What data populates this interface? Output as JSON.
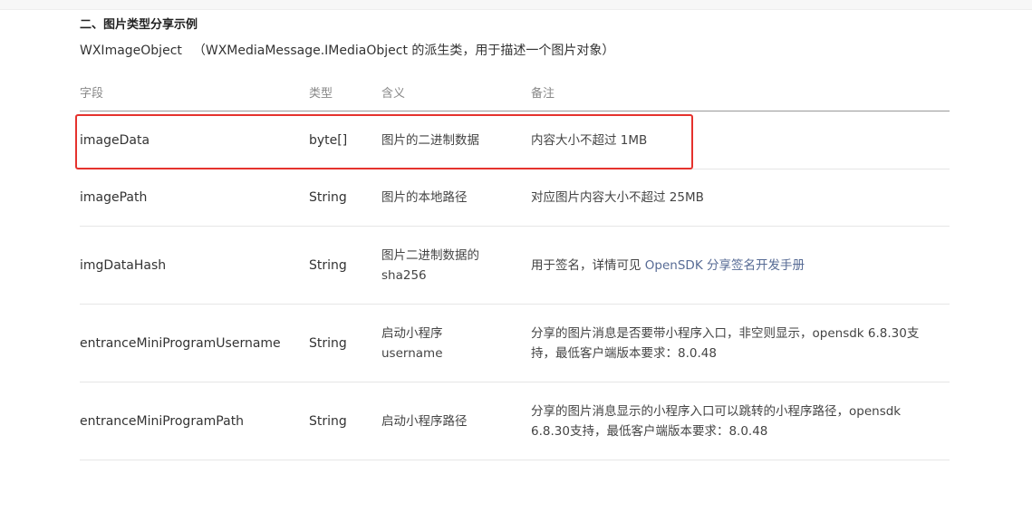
{
  "section": {
    "title": "二、图片类型分享示例"
  },
  "intro": {
    "class_name": "WXImageObject",
    "description": "（WXMediaMessage.IMediaObject 的派生类，用于描述一个图片对象）"
  },
  "table": {
    "headers": {
      "field": "字段",
      "type": "类型",
      "meaning": "含义",
      "note": "备注"
    },
    "rows": [
      {
        "field": "imageData",
        "type": "byte[]",
        "meaning": "图片的二进制数据",
        "note": "内容大小不超过 1MB"
      },
      {
        "field": "imagePath",
        "type": "String",
        "meaning": "图片的本地路径",
        "note": "对应图片内容大小不超过 25MB"
      },
      {
        "field": "imgDataHash",
        "type": "String",
        "meaning": "图片二进制数据的 sha256",
        "note_prefix": "用于签名，详情可见 ",
        "note_link": "OpenSDK 分享签名开发手册"
      },
      {
        "field": "entranceMiniProgramUsername",
        "type": "String",
        "meaning": "启动小程序 username",
        "note": "分享的图片消息是否要带小程序入口，非空则显示，opensdk 6.8.30支持，最低客户端版本要求：8.0.48"
      },
      {
        "field": "entranceMiniProgramPath",
        "type": "String",
        "meaning": "启动小程序路径",
        "note": "分享的图片消息显示的小程序入口可以跳转的小程序路径，opensdk 6.8.30支持，最低客户端版本要求：8.0.48"
      }
    ]
  },
  "colors": {
    "highlight_border": "#e5322d",
    "link": "#576b95",
    "header_text": "#888888"
  }
}
